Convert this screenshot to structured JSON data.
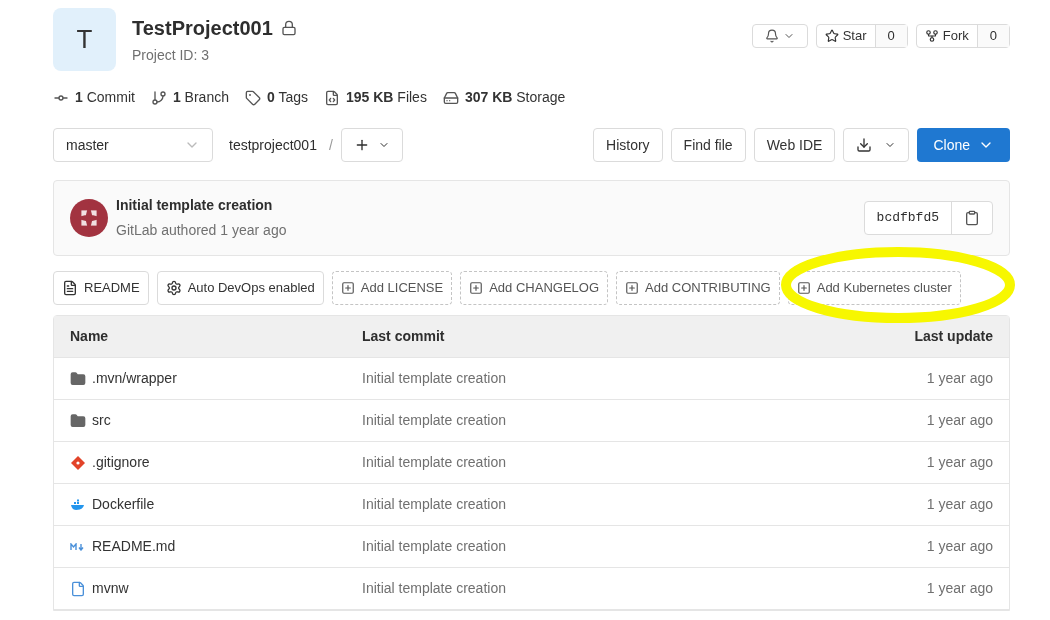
{
  "project": {
    "avatar_letter": "T",
    "name": "TestProject001",
    "private": true,
    "id_label": "Project ID: 3"
  },
  "actions": {
    "star": {
      "label": "Star",
      "count": "0"
    },
    "fork": {
      "label": "Fork",
      "count": "0"
    }
  },
  "stats": [
    {
      "kind": "commit",
      "text": "**1** Commit"
    },
    {
      "kind": "branch",
      "text": "**1** Branch"
    },
    {
      "kind": "tag",
      "text": "**0** Tags"
    },
    {
      "kind": "files",
      "text": "**195 KB** Files"
    },
    {
      "kind": "storage",
      "text": "**307 KB** Storage"
    }
  ],
  "toolbar": {
    "branch": "master",
    "path": "testproject001",
    "separator": "/",
    "buttons": [
      "History",
      "Find file",
      "Web IDE"
    ],
    "clone": "Clone"
  },
  "last_commit": {
    "title": "Initial template creation",
    "meta": "GitLab authored 1 year ago",
    "sha": "bcdfbfd5"
  },
  "quick_buttons": [
    {
      "kind": "readme",
      "label": "README"
    },
    {
      "kind": "devops",
      "label": "Auto DevOps enabled"
    },
    {
      "kind": "add",
      "label": "Add LICENSE"
    },
    {
      "kind": "add",
      "label": "Add CHANGELOG"
    },
    {
      "kind": "add",
      "label": "Add CONTRIBUTING"
    },
    {
      "kind": "add",
      "label": "Add Kubernetes cluster",
      "highlighted": true
    }
  ],
  "table": {
    "columns": [
      "Name",
      "Last commit",
      "Last update"
    ],
    "rows": [
      {
        "kind": "folder",
        "name": ".mvn/wrapper",
        "commit": "Initial template creation",
        "updated": "1 year ago"
      },
      {
        "kind": "folder",
        "name": "src",
        "commit": "Initial template creation",
        "updated": "1 year ago"
      },
      {
        "kind": "git",
        "name": ".gitignore",
        "commit": "Initial template creation",
        "updated": "1 year ago"
      },
      {
        "kind": "docker",
        "name": "Dockerfile",
        "commit": "Initial template creation",
        "updated": "1 year ago"
      },
      {
        "kind": "markdown",
        "name": "README.md",
        "commit": "Initial template creation",
        "updated": "1 year ago"
      },
      {
        "kind": "file",
        "name": "mvnw",
        "commit": "Initial template creation",
        "updated": "1 year ago"
      }
    ]
  }
}
